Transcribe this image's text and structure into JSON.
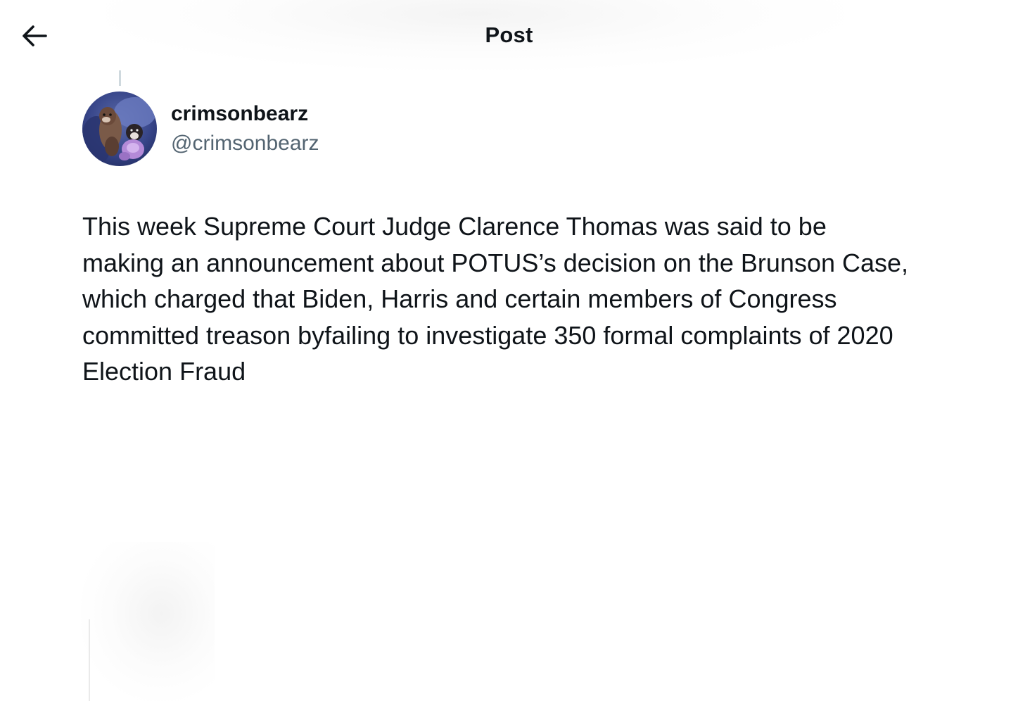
{
  "header": {
    "title": "Post",
    "back_icon": "arrow-left-icon"
  },
  "post": {
    "author": {
      "display_name": "crimsonbearz",
      "handle": "@crimsonbearz",
      "avatar_icon": "profile-photo"
    },
    "text": "This week Supreme Court Judge Clarence Thomas was said to be making an announcement about POTUS’s decision on the Brunson Case, which charged that Biden, Harris and certain members of Congress committed treason byfailing to investigate 350 formal complaints of 2020 Election Fraud"
  },
  "colors": {
    "text_primary": "#0f1419",
    "text_secondary": "#536471",
    "background": "#ffffff",
    "thread_line": "#cfd9de"
  }
}
